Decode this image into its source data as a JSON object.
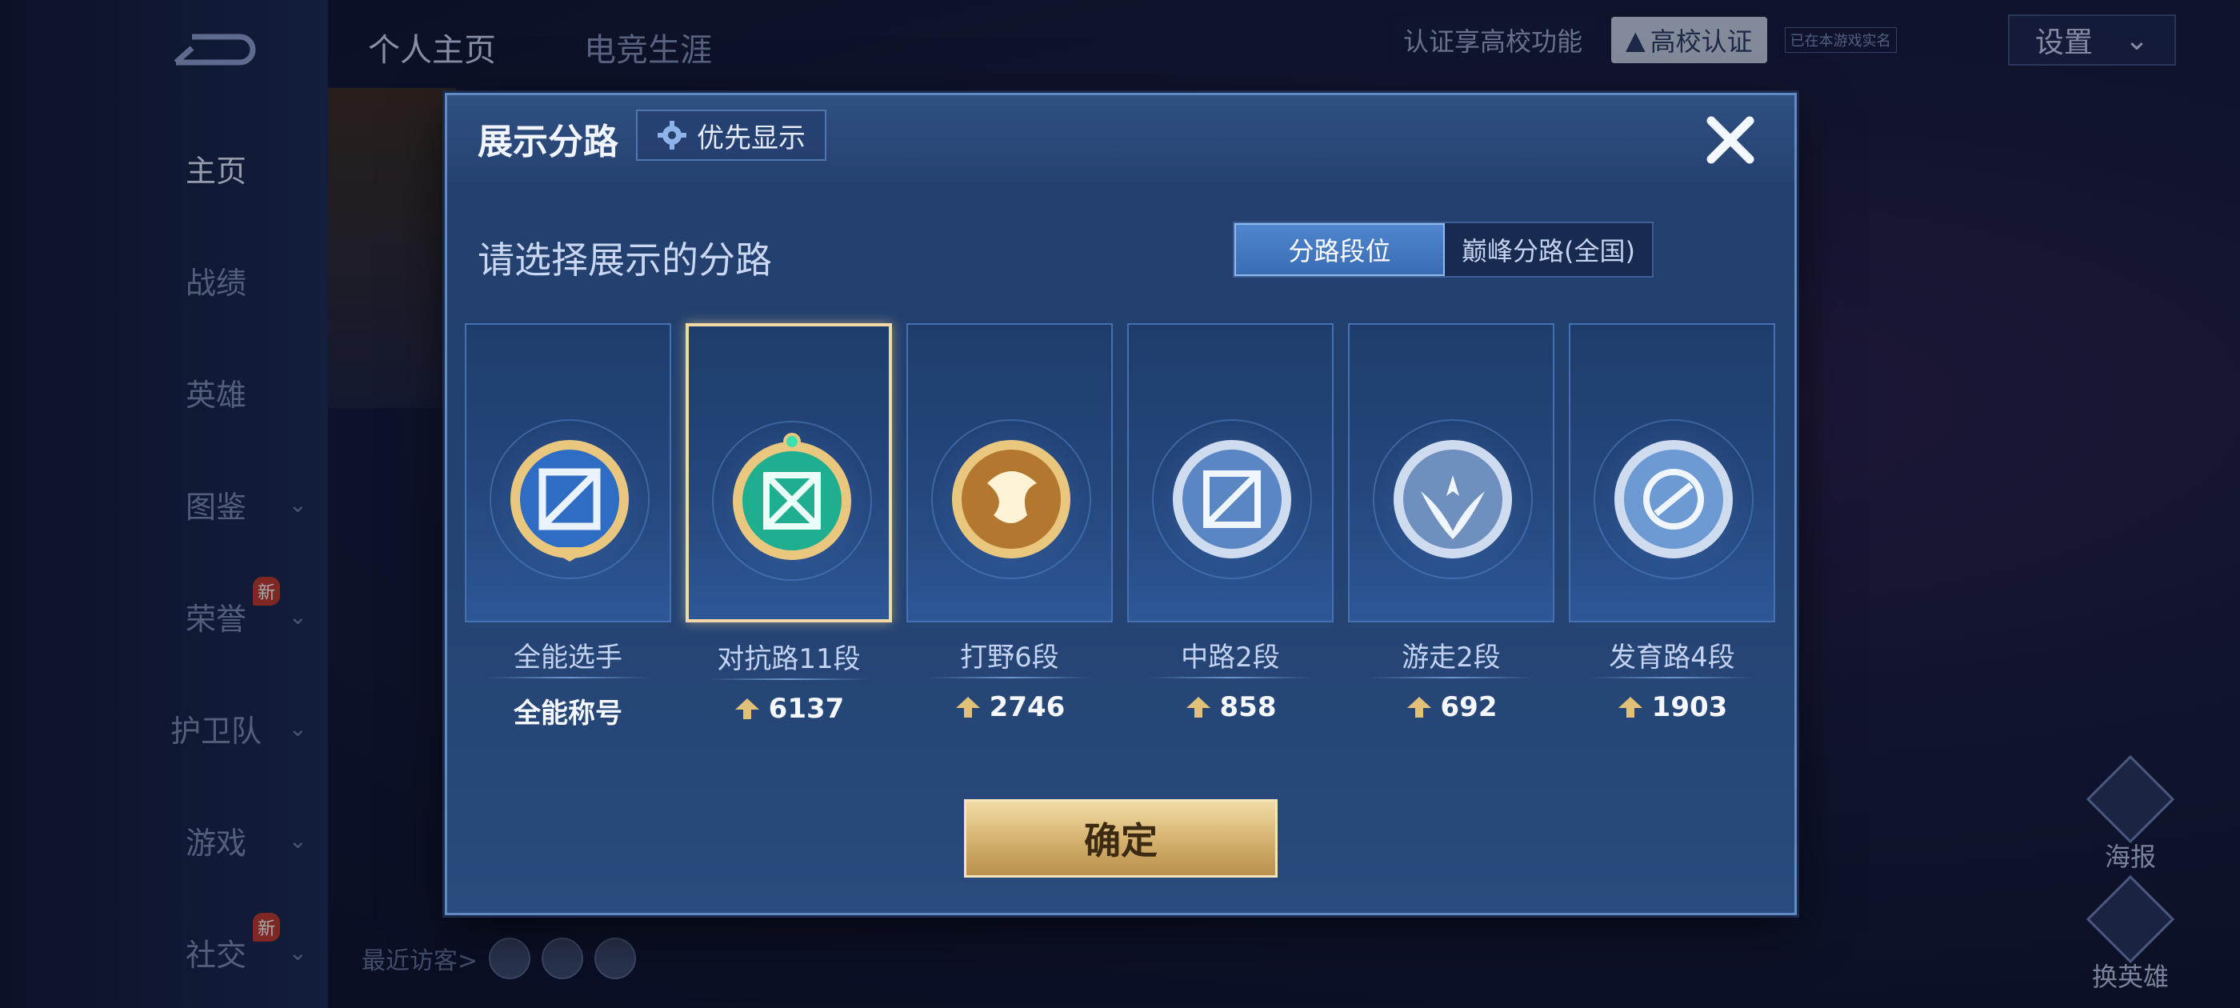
{
  "sidebar": {
    "items": [
      {
        "label": "主页",
        "active": true
      },
      {
        "label": "战绩"
      },
      {
        "label": "英雄"
      },
      {
        "label": "图鉴",
        "expandable": true
      },
      {
        "label": "荣誉",
        "expandable": true,
        "badge": "新"
      },
      {
        "label": "护卫队",
        "expandable": true
      },
      {
        "label": "游戏",
        "expandable": true
      },
      {
        "label": "社交",
        "expandable": true,
        "badge": "新"
      }
    ]
  },
  "top_tabs": [
    "个人主页",
    "电竞生涯"
  ],
  "top_right": {
    "cert_text": "认证享高校功能",
    "cert_button": "高校认证",
    "cert_small": "已在本游戏实名",
    "settings": "设置"
  },
  "recent_visitors_label": "最近访客>",
  "right_actions": {
    "poster": "海报",
    "change_hero": "换英雄"
  },
  "modal": {
    "title": "展示分路",
    "priority_label": "优先显示",
    "subtitle": "请选择展示的分路",
    "tabs": [
      {
        "label": "分路段位",
        "active": true
      },
      {
        "label": "巅峰分路(全国)",
        "active": false
      }
    ],
    "cards": [
      {
        "name": "全能选手",
        "value": "全能称号",
        "show_arrow": false,
        "emblem": "all-round-emblem-icon",
        "selected": false
      },
      {
        "name": "对抗路11段",
        "value": "6137",
        "show_arrow": true,
        "emblem": "clash-lane-emblem-icon",
        "selected": true
      },
      {
        "name": "打野6段",
        "value": "2746",
        "show_arrow": true,
        "emblem": "jungle-emblem-icon",
        "selected": false
      },
      {
        "name": "中路2段",
        "value": "858",
        "show_arrow": true,
        "emblem": "mid-lane-emblem-icon",
        "selected": false
      },
      {
        "name": "游走2段",
        "value": "692",
        "show_arrow": true,
        "emblem": "roam-emblem-icon",
        "selected": false
      },
      {
        "name": "发育路4段",
        "value": "1903",
        "show_arrow": true,
        "emblem": "farm-lane-emblem-icon",
        "selected": false
      }
    ],
    "confirm_label": "确定"
  },
  "colors": {
    "accent_gold": "#d4b06c",
    "accent_blue": "#4f86cf",
    "selected_border": "#f1d8a4"
  }
}
